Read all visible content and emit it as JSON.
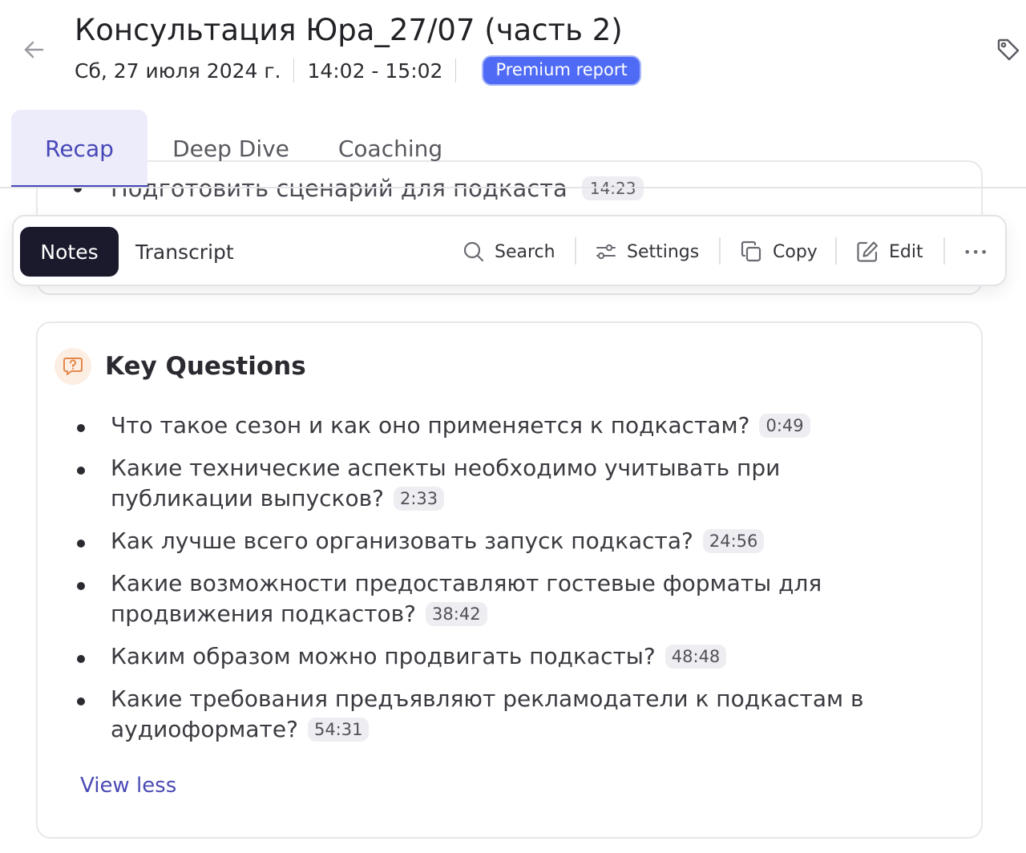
{
  "header": {
    "title": "Консультация Юра_27/07 (часть 2)",
    "date": "Сб, 27 июля 2024 г.",
    "time": "14:02 - 15:02",
    "badge": "Premium report"
  },
  "tabs": [
    {
      "label": "Recap",
      "active": true
    },
    {
      "label": "Deep Dive",
      "active": false
    },
    {
      "label": "Coaching",
      "active": false
    }
  ],
  "scrolled": {
    "text": "Подготовить сценарий для подкаста",
    "timestamp": "14:23"
  },
  "toolbar": {
    "notes": "Notes",
    "transcript": "Transcript",
    "search": "Search",
    "settings": "Settings",
    "copy": "Copy",
    "edit": "Edit",
    "more": "•••"
  },
  "key_questions": {
    "title": "Key Questions",
    "items": [
      {
        "text": "Что такое сезон и как оно применяется к подкастам?",
        "timestamp": "0:49"
      },
      {
        "text": "Какие технические аспекты необходимо учитывать при публикации выпусков?",
        "timestamp": "2:33"
      },
      {
        "text": "Как лучше всего организовать запуск подкаста?",
        "timestamp": "24:56"
      },
      {
        "text": "Какие возможности предоставляют гостевые форматы для продвижения подкастов?",
        "timestamp": "38:42"
      },
      {
        "text": "Каким образом можно продвигать подкасты?",
        "timestamp": "48:48"
      },
      {
        "text": "Какие требования предъявляют рекламодатели к подкастам в аудиоформате?",
        "timestamp": "54:31"
      }
    ],
    "view_less": "View less"
  },
  "colors": {
    "accent": "#4747b8",
    "badge": "#4f6bf5",
    "active_pill": "#1b1a2c",
    "active_tab_bg": "#ececfa"
  }
}
